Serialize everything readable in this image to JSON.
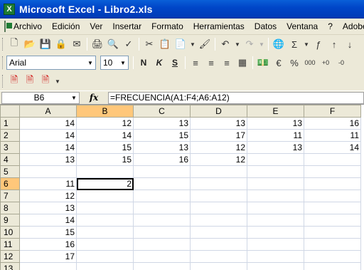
{
  "window": {
    "title": "Microsoft Excel - Libro2.xls"
  },
  "menu": [
    "Archivo",
    "Edición",
    "Ver",
    "Insertar",
    "Formato",
    "Herramientas",
    "Datos",
    "Ventana",
    "?",
    "Adobe"
  ],
  "toolbar_font": {
    "font": "Arial",
    "size": "10"
  },
  "formula_bar": {
    "cell_ref": "B6",
    "fx": "fx",
    "formula": "=FRECUENCIA(A1:F4;A6:A12)"
  },
  "columns": [
    "A",
    "B",
    "C",
    "D",
    "E",
    "F"
  ],
  "rows": [
    {
      "num": "1",
      "cells": [
        "14",
        "12",
        "13",
        "13",
        "13",
        "16"
      ]
    },
    {
      "num": "2",
      "cells": [
        "14",
        "14",
        "15",
        "17",
        "11",
        "11"
      ]
    },
    {
      "num": "3",
      "cells": [
        "14",
        "15",
        "13",
        "12",
        "13",
        "14"
      ]
    },
    {
      "num": "4",
      "cells": [
        "13",
        "15",
        "16",
        "12",
        "",
        ""
      ]
    },
    {
      "num": "5",
      "cells": [
        "",
        "",
        "",
        "",
        "",
        ""
      ]
    },
    {
      "num": "6",
      "cells": [
        "11",
        "2",
        "",
        "",
        "",
        ""
      ]
    },
    {
      "num": "7",
      "cells": [
        "12",
        "",
        "",
        "",
        "",
        ""
      ]
    },
    {
      "num": "8",
      "cells": [
        "13",
        "",
        "",
        "",
        "",
        ""
      ]
    },
    {
      "num": "9",
      "cells": [
        "14",
        "",
        "",
        "",
        "",
        ""
      ]
    },
    {
      "num": "10",
      "cells": [
        "15",
        "",
        "",
        "",
        "",
        ""
      ]
    },
    {
      "num": "11",
      "cells": [
        "16",
        "",
        "",
        "",
        "",
        ""
      ]
    },
    {
      "num": "12",
      "cells": [
        "17",
        "",
        "",
        "",
        "",
        ""
      ]
    },
    {
      "num": "13",
      "cells": [
        "",
        "",
        "",
        "",
        "",
        ""
      ]
    }
  ]
}
